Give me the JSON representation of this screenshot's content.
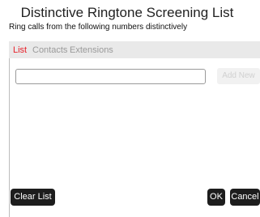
{
  "dialog": {
    "title": "Distinctive Ringtone Screening List",
    "subtitle": "Ring calls from the following numbers distinctively"
  },
  "tabs": {
    "list": "List",
    "contacts": "Contacts",
    "extensions": "Extensions",
    "active_color": "#e8202a",
    "inactive_color": "#9a9a9a"
  },
  "entry": {
    "value": "",
    "add_label": "Add New"
  },
  "footer": {
    "clear_label": "Clear List",
    "ok_label": "OK",
    "cancel_label": "Cancel"
  }
}
